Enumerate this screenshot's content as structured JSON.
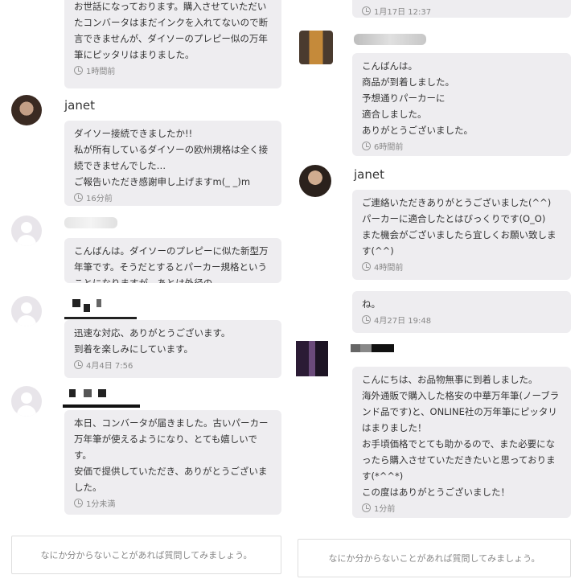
{
  "left": {
    "messages": [
      {
        "text": "お世話になっております。購入させていただいたコンバータはまだインクを入れてないので断言できませんが、ダイソーのプレピー似の万年筆にピッタリはまりました。",
        "time": "1時間前"
      },
      {
        "user": "janet",
        "text": "ダイソー接続できましたか!!\n私が所有しているダイソーの欧州規格は全く接続できませんでした…\nご報告いただき感謝申し上げますm(_ _)m",
        "time": "16分前"
      },
      {
        "text": "こんばんは。ダイソーのプレピーに似た新型万年筆です。そうだとするとパーカー規格ということになりますが、あとは外径の",
        "time": ""
      },
      {
        "text": "迅速な対応、ありがとうございます。\n到着を楽しみにしています。",
        "time": "4月4日 7:56"
      },
      {
        "text": "本日、コンバータが届きました。古いパーカー万年筆が使えるようになり、とても嬉しいです。\n安価で提供していただき、ありがとうございました。",
        "time": "1分未満"
      }
    ],
    "ask_placeholder": "なにか分からないことがあれば質問してみましょう。"
  },
  "right": {
    "messages": [
      {
        "text": "",
        "time": "1月17日 12:37"
      },
      {
        "text": "こんばんは。\n商品が到着しました。\n予想通りパーカーに\n適合しました。\nありがとうございました。",
        "time": "6時間前"
      },
      {
        "user": "janet",
        "text": "ご連絡いただきありがとうございました(^^)\nパーカーに適合したとはびっくりです(O_O)\nまた機会がございましたら宜しくお願い致します(^^)",
        "time": "4時間前"
      },
      {
        "text": "ね。",
        "time": "4月27日 19:48"
      },
      {
        "text": "こんにちは、お品物無事に到着しました。\n海外通販で購入した格安の中華万年筆(ノーブランド品です)と、ONLINE社の万年筆にピッタリはまりました！\nお手頃価格でとても助かるので、また必要になったら購入させていただきたいと思っております(*^^*)\nこの度はありがとうございました！",
        "time": "1分前"
      }
    ],
    "ask_placeholder": "なにか分からないことがあれば質問してみましょう。"
  },
  "icons": {
    "clock": "clock-icon",
    "avatar": "default-avatar-icon"
  }
}
